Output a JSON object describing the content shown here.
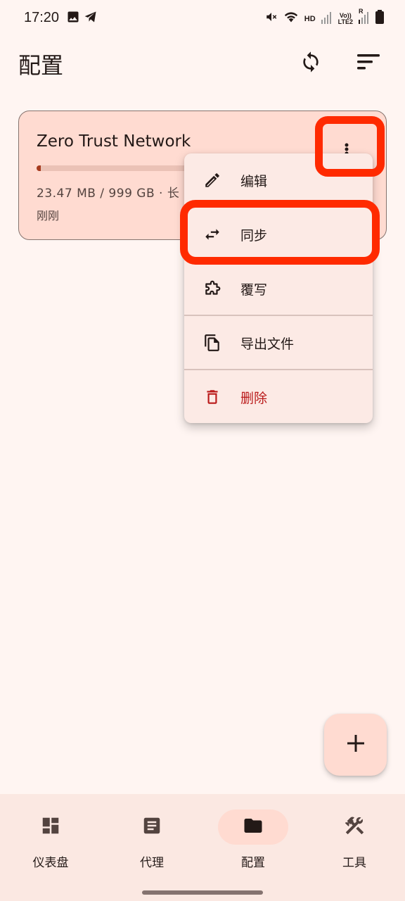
{
  "status_bar": {
    "time": "17:20",
    "network_label": "HD",
    "volte_label_top": "Vo))",
    "volte_label_bottom": "LTE2",
    "roaming_label": "R",
    "icons": [
      "image-icon",
      "telegram-icon",
      "mute-icon",
      "wifi-icon",
      "signal-icon",
      "battery-icon"
    ]
  },
  "app_bar": {
    "title": "配置",
    "icons": [
      "sync-icon",
      "sort-icon"
    ]
  },
  "profile_card": {
    "name": "Zero Trust Network",
    "usage": "23.47 MB / 999 GB · 长",
    "updated": "刚刚",
    "usage_fraction": 0.02,
    "more_icon": "more-vert-icon"
  },
  "menu": {
    "items": [
      {
        "label": "编辑",
        "icon": "edit-icon"
      },
      {
        "label": "同步",
        "icon": "swap-horiz-icon"
      },
      {
        "label": "覆写",
        "icon": "extension-icon"
      },
      {
        "label": "导出文件",
        "icon": "file-copy-icon"
      },
      {
        "label": "删除",
        "icon": "delete-icon"
      }
    ]
  },
  "fab": {
    "icon": "add-icon"
  },
  "bottom_nav": {
    "items": [
      {
        "label": "仪表盘",
        "icon": "dashboard-icon",
        "active": false
      },
      {
        "label": "代理",
        "icon": "article-icon",
        "active": false
      },
      {
        "label": "配置",
        "icon": "folder-icon",
        "active": true
      },
      {
        "label": "工具",
        "icon": "tools-icon",
        "active": false
      }
    ]
  },
  "colors": {
    "background": "#fff5f2",
    "card": "#ffdbd1",
    "menu": "#fceae5",
    "danger": "#ba1a1a",
    "highlight": "#ff2a00",
    "nav_background": "#fbe8e2"
  }
}
